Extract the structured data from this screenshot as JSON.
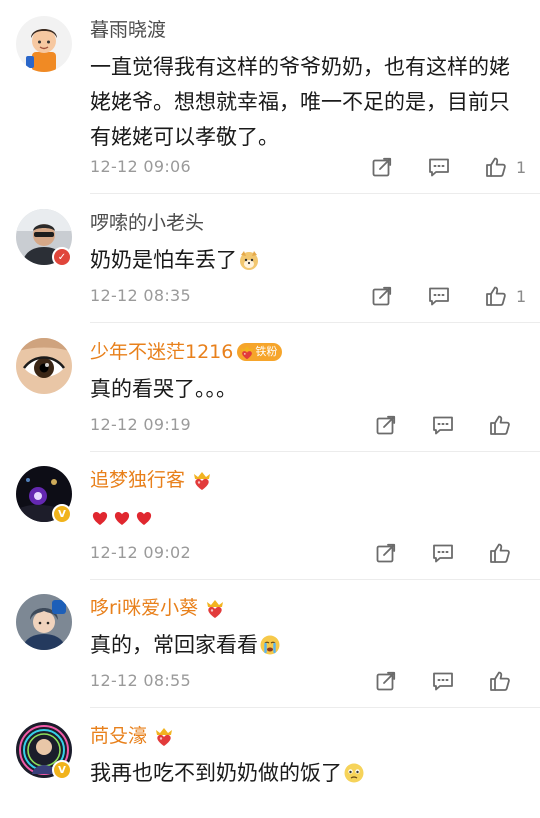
{
  "comments": [
    {
      "name": "暮雨晓渡",
      "name_style": "normal",
      "text": "一直觉得我有这样的爷爷奶奶，也有这样的姥姥姥爷。想想就幸福，唯一不足的是，目前只有姥姥可以孝敬了。",
      "time": "12-12 09:06",
      "likes": "1",
      "avatar": "cartoon-boy-avatar"
    },
    {
      "name": "啰嗦的小老头",
      "name_style": "normal",
      "text": "奶奶是怕车丢了",
      "emoji": "doge-emoji",
      "time": "12-12 08:35",
      "likes": "1",
      "avatar": "man-sunglasses-avatar"
    },
    {
      "name": "少年不迷茫1216",
      "name_style": "orange",
      "fan_badge": "铁粉",
      "text": "真的看哭了。。。",
      "time": "12-12 09:19",
      "likes": "",
      "avatar": "eye-closeup-avatar"
    },
    {
      "name": "追梦独行客",
      "name_style": "orange",
      "text": "",
      "emoji": "three-red-hearts",
      "time": "12-12 09:02",
      "likes": "",
      "avatar": "dark-lights-avatar"
    },
    {
      "name": "哆ri咪爱小葵",
      "name_style": "orange",
      "text": "真的，常回家看看",
      "emoji": "crying-emoji",
      "time": "12-12 08:55",
      "likes": "",
      "avatar": "anime-boy-avatar"
    },
    {
      "name": "苘殳濠",
      "name_style": "orange",
      "text": "我再也吃不到奶奶做的饭了",
      "emoji": "sad-emoji",
      "time": "",
      "likes": "",
      "avatar": "neon-ring-avatar"
    }
  ],
  "icons": {
    "forward": "share-square-icon",
    "comment": "comment-bubble-icon",
    "like": "thumbs-up-icon",
    "vip": "red-heart-crown-vip-icon"
  },
  "colors": {
    "orange_name": "#e8801b",
    "gray_name": "#4c4c4c",
    "time": "#9a9a9a",
    "icon": "#6b6b6b"
  }
}
